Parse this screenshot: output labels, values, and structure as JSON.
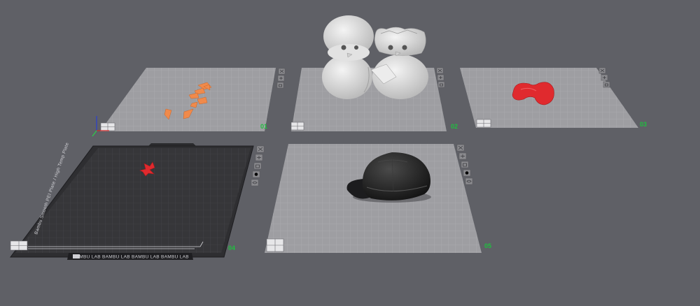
{
  "viewport": {
    "background": "#5f6066",
    "accent_label_color": "#1fbf3f"
  },
  "plates": [
    {
      "number": "01",
      "bed": "light-gray",
      "object": "orange parts"
    },
    {
      "number": "02",
      "bed": "light-gray",
      "object": "white figurines"
    },
    {
      "number": "03",
      "bed": "light-gray",
      "object": "red part"
    },
    {
      "number": "04",
      "bed": "textured-pei-dark",
      "object": "red part"
    },
    {
      "number": "05",
      "bed": "light-gray",
      "object": "black cap"
    }
  ],
  "plate04_bed": {
    "side_text": "Bambu Smooth PEI Plate / High Temp Plate",
    "bottom_text": "BAMBU LAB   BAMBU LAB   BAMBU LAB   BAMBU LAB"
  },
  "plate_toolbar_icons": [
    "close-icon",
    "grid-icon",
    "lock-icon",
    "settings-icon",
    "eye-icon"
  ],
  "plate_corner_icon": "plate-grid-icon"
}
